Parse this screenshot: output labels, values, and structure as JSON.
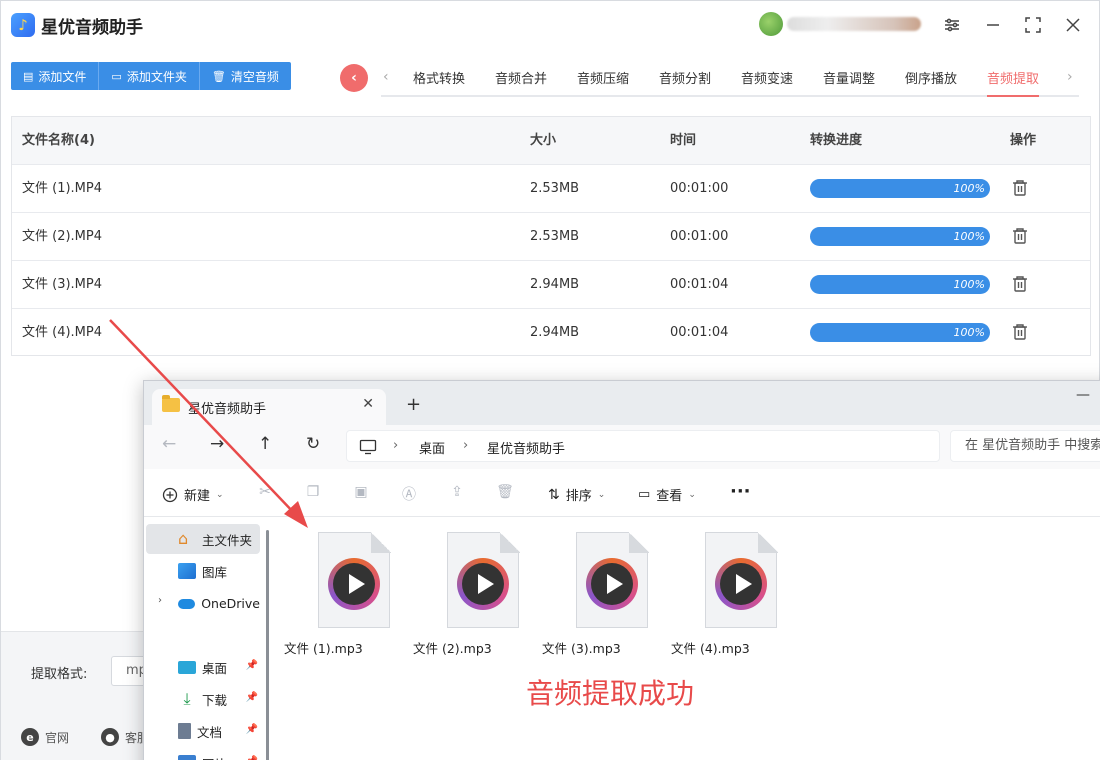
{
  "app": {
    "title": "星优音频助手",
    "logo_glyph": "♪",
    "window_controls": [
      "settings-icon",
      "minimize-icon",
      "maximize-icon",
      "close-icon"
    ]
  },
  "toolbar": {
    "add_file": "添加文件",
    "add_folder": "添加文件夹",
    "clear_audio": "清空音频"
  },
  "tabs": [
    "格式转换",
    "音频合并",
    "音频压缩",
    "音频分割",
    "音频变速",
    "音量调整",
    "倒序播放",
    "音频提取"
  ],
  "active_tab": "音频提取",
  "table": {
    "headers": [
      "文件名称(4)",
      "大小",
      "时间",
      "转换进度",
      "操作"
    ],
    "rows": [
      {
        "name": "文件 (1).MP4",
        "size": "2.53MB",
        "time": "00:01:00",
        "progress": "100%"
      },
      {
        "name": "文件 (2).MP4",
        "size": "2.53MB",
        "time": "00:01:00",
        "progress": "100%"
      },
      {
        "name": "文件 (3).MP4",
        "size": "2.94MB",
        "time": "00:01:04",
        "progress": "100%"
      },
      {
        "name": "文件 (4).MP4",
        "size": "2.94MB",
        "time": "00:01:04",
        "progress": "100%"
      }
    ]
  },
  "footer": {
    "format_label": "提取格式:",
    "format_value": "mp",
    "link_website": "官网",
    "link_service": "客服"
  },
  "explorer": {
    "tab_title": "星优音频助手",
    "path": [
      "桌面",
      "星优音频助手"
    ],
    "search_placeholder": "在 星优音频助手 中搜索",
    "cmd_new": "新建",
    "cmd_sort": "排序",
    "cmd_view": "查看",
    "sidebar": [
      {
        "label": "主文件夹",
        "icon": "home-icon",
        "pinned": false
      },
      {
        "label": "图库",
        "icon": "gallery-icon",
        "pinned": false
      },
      {
        "label": "OneDrive",
        "icon": "cloud-icon",
        "pinned": false
      },
      {
        "label": "桌面",
        "icon": "desktop-icon",
        "pinned": true
      },
      {
        "label": "下载",
        "icon": "download-icon",
        "pinned": true
      },
      {
        "label": "文档",
        "icon": "document-icon",
        "pinned": true
      },
      {
        "label": "图片",
        "icon": "pictures-icon",
        "pinned": true
      }
    ],
    "files": [
      "文件 (1).mp3",
      "文件 (2).mp3",
      "文件 (3).mp3",
      "文件 (4).mp3"
    ]
  },
  "annotation": "音频提取成功",
  "colors": {
    "accent_blue": "#3a8ee6",
    "accent_red": "#f06c6c",
    "annotation_red": "#e84a4a"
  }
}
